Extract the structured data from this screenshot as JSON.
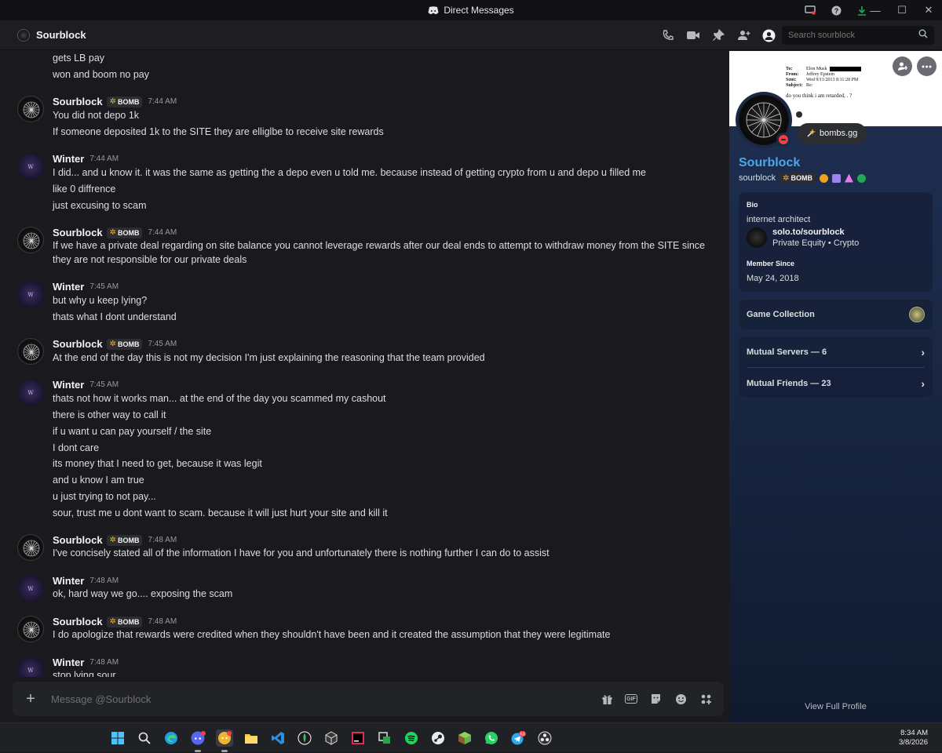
{
  "window": {
    "title": "Direct Messages",
    "controls": [
      "—",
      "☐",
      "✕"
    ]
  },
  "header": {
    "dm_name": "Sourblock",
    "search_placeholder": "Search sourblock"
  },
  "tag_label": "BOMB",
  "messages": [
    {
      "lines": [
        "gets LB pay",
        "won and boom no pay"
      ]
    },
    {
      "author": "Sourblock",
      "time": "7:44 AM",
      "lines": [
        "You did not depo 1k",
        "If someone deposited 1k to the SITE they are elliglbe to receive site rewards"
      ]
    },
    {
      "author": "Winter",
      "time": "7:44 AM",
      "lines": [
        "I did... and u know it. it was the same as getting the a depo even u told me. because instead of getting crypto from u and depo u filled me",
        "like 0 diffrence",
        "just excusing to scam"
      ]
    },
    {
      "author": "Sourblock",
      "time": "7:44 AM",
      "lines": [
        "If we have a private deal regarding on site balance you cannot leverage rewards after our deal ends to attempt to withdraw money from the SITE since",
        "they are not responsible for our private deals"
      ]
    },
    {
      "author": "Winter",
      "time": "7:45 AM",
      "lines": [
        "but why u keep lying?",
        "thats what I dont understand"
      ]
    },
    {
      "author": "Sourblock",
      "time": "7:45 AM",
      "lines": [
        "At the end of the day this is not my decision I'm just explaining the reasoning that the team provided"
      ]
    },
    {
      "author": "Winter",
      "time": "7:45 AM",
      "lines": [
        "thats not how it works man... at the end of the day you scammed my cashout",
        "there is other way to call it",
        "if u want u can pay yourself / the site",
        "I dont care",
        "its money that I need to get, because it was legit",
        "and u know I am true",
        "u just trying to not pay...",
        "sour, trust me u dont want to scam. because it will just hurt your site and kill it"
      ]
    },
    {
      "author": "Sourblock",
      "time": "7:48 AM",
      "lines": [
        "I've concisely stated all of the information I have for you and unfortunately there is nothing further I can do to assist"
      ]
    },
    {
      "author": "Winter",
      "time": "7:48 AM",
      "lines": [
        "ok, hard way we go.... exposing the scam"
      ]
    },
    {
      "author": "Sourblock",
      "time": "7:48 AM",
      "lines": [
        "I do apologize that rewards were credited when they shouldn't have been and it created the assumption that they were legitimate"
      ]
    },
    {
      "author": "Winter",
      "time": "7:48 AM",
      "lines": [
        "stop lying sour"
      ]
    }
  ],
  "composer": {
    "placeholder": "Message @Sourblock",
    "gif_label": "GIF"
  },
  "profile": {
    "banner_email": {
      "to_label": "To:",
      "to": "Elon Musk",
      "from_label": "From:",
      "from": "Jeffrey Epstein",
      "sent_label": "Sent:",
      "sent": "Wed 9/11/2013 8:11:28 PM",
      "subject_label": "Subject:",
      "subject": "Re:",
      "body": "do you think i am retarded, . ?"
    },
    "status": "bombs.gg",
    "display_name": "Sourblock",
    "username": "sourblock",
    "tag": "BOMB",
    "bio_label": "Bio",
    "bio": "internet architect",
    "link_title": "solo.to/sourblock",
    "link_sub": "Private Equity • Crypto",
    "member_since_label": "Member Since",
    "member_since": "May 24, 2018",
    "game_collection": "Game Collection",
    "mutual_servers": "Mutual Servers — 6",
    "mutual_friends": "Mutual Friends — 23",
    "view_full": "View Full Profile"
  },
  "clock": {
    "time": "8:34 AM",
    "date": "3/8/2026"
  },
  "taskbar": {
    "telegram_badge": "63"
  }
}
